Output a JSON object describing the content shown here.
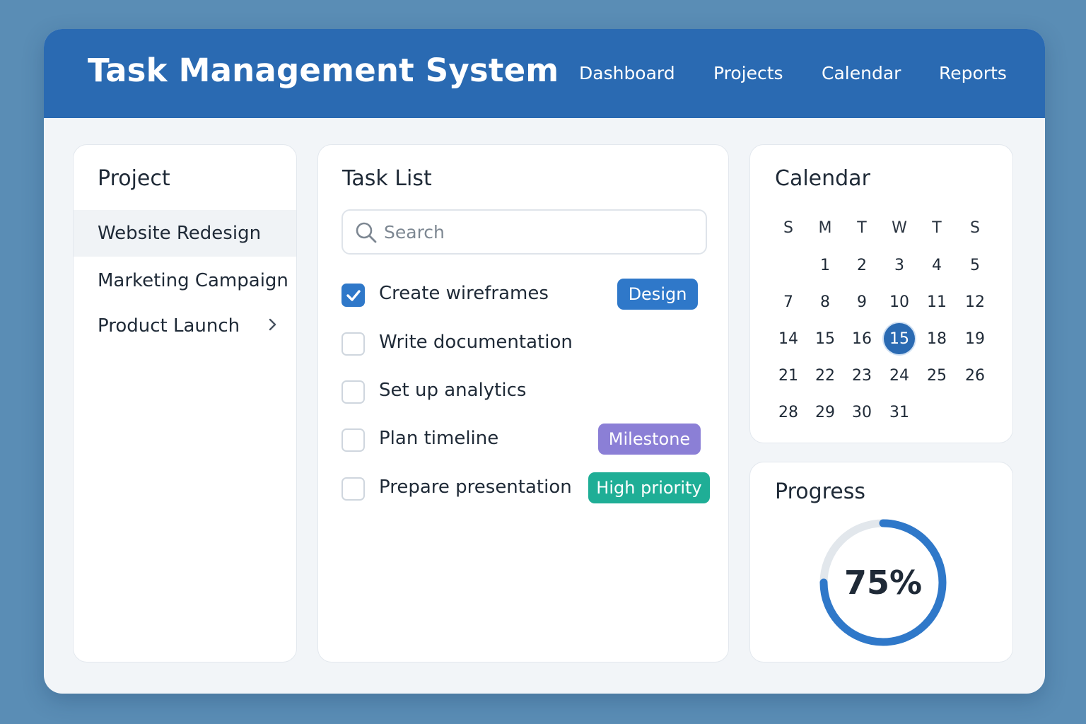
{
  "header": {
    "title": "Task Management System",
    "nav": [
      "Dashboard",
      "Projects",
      "Calendar",
      "Reports"
    ]
  },
  "projects": {
    "title": "Project",
    "items": [
      {
        "label": "Website Redesign",
        "active": true
      },
      {
        "label": "Marketing Campaign",
        "active": false
      },
      {
        "label": "Product Launch",
        "active": false,
        "chevron": "chevron-right-icon"
      }
    ]
  },
  "tasks": {
    "title": "Task List",
    "search_placeholder": "Search",
    "items": [
      {
        "label": "Create wireframes",
        "checked": true,
        "tag": "Design",
        "tag_color": "#2f78c9"
      },
      {
        "label": "Write documentation",
        "checked": false
      },
      {
        "label": "Set up analytics",
        "checked": false
      },
      {
        "label": "Plan timeline",
        "checked": false,
        "tag": "Milestone",
        "tag_color": "#8b7fd6"
      },
      {
        "label": "Prepare presentation",
        "checked": false,
        "tag": "High priority",
        "tag_color": "#1fae96"
      }
    ]
  },
  "calendar": {
    "title": "Calendar",
    "weekdays": [
      "S",
      "M",
      "T",
      "W",
      "T",
      "S"
    ],
    "weeks": [
      [
        "",
        "1",
        "2",
        "3",
        "4",
        "5"
      ],
      [
        "7",
        "8",
        "9",
        "10",
        "11",
        "12"
      ],
      [
        "14",
        "15",
        "16",
        "15",
        "18",
        "19"
      ],
      [
        "21",
        "22",
        "23",
        "24",
        "25",
        "26"
      ],
      [
        "28",
        "29",
        "30",
        "31",
        "",
        ""
      ]
    ],
    "selected": {
      "week": 2,
      "day": 3
    },
    "accent": "#2a6ab2"
  },
  "progress": {
    "title": "Progress",
    "label": "75%",
    "value": 0.75,
    "color": "#2f78c9",
    "track_color": "#e2e7ec"
  }
}
